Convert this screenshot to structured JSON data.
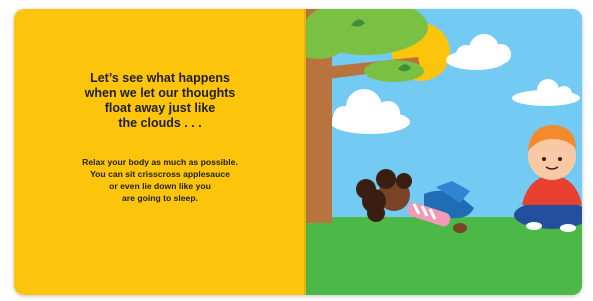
{
  "left_page": {
    "headline_lines": [
      "Let’s see what happens",
      "when we let our thoughts",
      "float away just like",
      "the clouds . . ."
    ],
    "body_lines": [
      "Relax your body as much as possible.",
      "You can sit crisscross applesauce",
      "or even lie down like you",
      "are going to sleep."
    ]
  },
  "colors": {
    "left_page_bg": "#fcc40a",
    "sky": "#73caf3",
    "grass": "#4cb848",
    "sun": "#fcc40a",
    "tree_trunk": "#b8733e",
    "leaves": "#7ac143"
  }
}
